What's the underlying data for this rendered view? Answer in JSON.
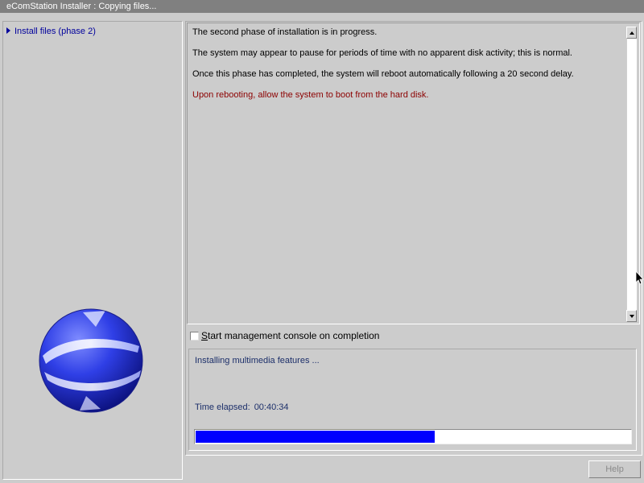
{
  "window": {
    "title": "eComStation Installer : Copying files..."
  },
  "sidebar": {
    "items": [
      {
        "label": "Install files (phase 2)",
        "icon": "triangle-right-icon"
      }
    ],
    "logo": "ecomstation-logo"
  },
  "messages": [
    "The second phase of installation is in progress.",
    "The system may appear to pause for periods of time with no apparent disk activity; this is normal.",
    "Once this phase has completed, the system will reboot automatically following a 20 second delay.",
    "Upon rebooting, allow the system to boot from the hard disk."
  ],
  "checkbox": {
    "label_accel": "S",
    "label_rest": "tart management console on completion",
    "checked": false
  },
  "status": {
    "text": "Installing multimedia features ...",
    "elapsed_label": "Time elapsed:",
    "elapsed_value": "00:40:34",
    "progress": 0.55
  },
  "buttons": {
    "help": "Help"
  },
  "colors": {
    "background": "#cccccc",
    "progress_fill": "#0000ff",
    "warning_text": "#8c0000",
    "status_text": "#1c2f6a",
    "nav_text": "#00009c"
  }
}
